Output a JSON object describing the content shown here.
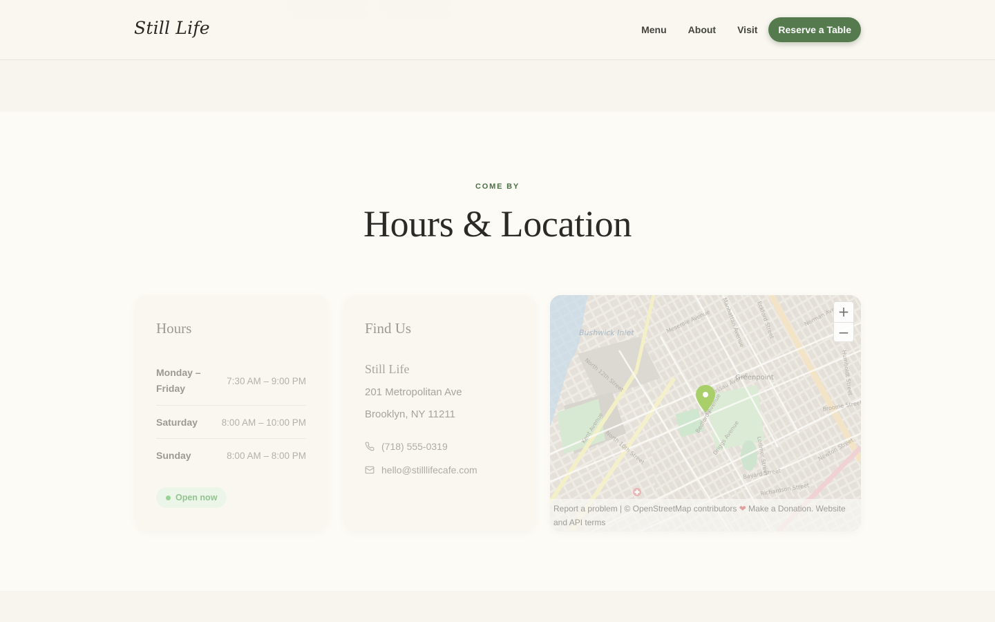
{
  "header": {
    "logo": "Still Life",
    "nav": [
      "Menu",
      "About",
      "Visit"
    ],
    "cta_label": "Reserve a Table"
  },
  "section": {
    "eyebrow": "COME BY",
    "title": "Hours & Location"
  },
  "hours": {
    "title": "Hours",
    "rows": [
      {
        "day": "Monday – Friday",
        "time": "7:30 AM – 9:00 PM"
      },
      {
        "day": "Saturday",
        "time": "8:00 AM – 10:00 PM"
      },
      {
        "day": "Sunday",
        "time": "8:00 AM – 8:00 PM"
      }
    ],
    "status": "Open now"
  },
  "find_us": {
    "title": "Find Us",
    "name": "Still Life",
    "address_line1": "201 Metropolitan Ave",
    "address_line2": "Brooklyn, NY 11211",
    "phone": "(718) 555-0319",
    "email": "hello@stilllifecafe.com"
  },
  "map": {
    "zoom_in": "+",
    "zoom_out": "−",
    "attribution_parts": [
      "Report a problem | © OpenStreetMap contributors ",
      "❤",
      " Make a Donation. Website and API terms"
    ],
    "labels": [
      "Bushwick Inlet",
      "Greenpoint",
      "Kent Avenue",
      "Bayard Street",
      "Richardson Street",
      "North 12th Street",
      "North 10th Street",
      "Meserole Avenue",
      "Nassau Avenue",
      "Driggs Avenue",
      "Bedford Avenue",
      "Lorimer Street",
      "Manhattan Avenue",
      "Eckford Street",
      "Norman Avenue",
      "Humboldt Street",
      "Broome Street",
      "Newton Street"
    ],
    "colors": {
      "pin": "#a9cf6a",
      "park": "#cfe8c8",
      "water": "#bcd6e8"
    }
  }
}
